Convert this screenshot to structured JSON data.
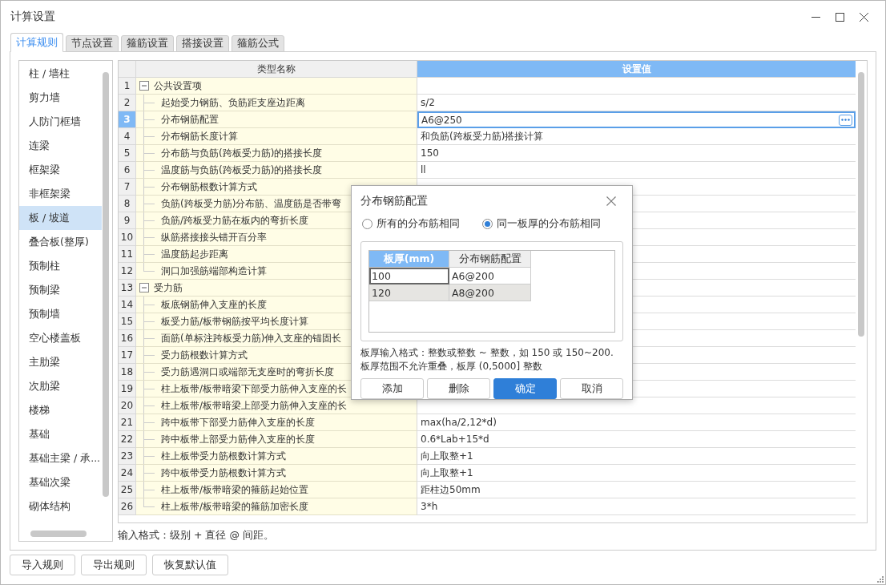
{
  "window": {
    "title": "计算设置"
  },
  "tabs": [
    {
      "label": "计算规则",
      "selected": true
    },
    {
      "label": "节点设置",
      "selected": false
    },
    {
      "label": "箍筋设置",
      "selected": false
    },
    {
      "label": "搭接设置",
      "selected": false
    },
    {
      "label": "箍筋公式",
      "selected": false
    }
  ],
  "sidebar": {
    "items": [
      {
        "label": "柱 / 墙柱",
        "selected": false
      },
      {
        "label": "剪力墙",
        "selected": false
      },
      {
        "label": "人防门框墙",
        "selected": false
      },
      {
        "label": "连梁",
        "selected": false
      },
      {
        "label": "框架梁",
        "selected": false
      },
      {
        "label": "非框架梁",
        "selected": false
      },
      {
        "label": "板 / 坡道",
        "selected": true
      },
      {
        "label": "叠合板(整厚)",
        "selected": false
      },
      {
        "label": "预制柱",
        "selected": false
      },
      {
        "label": "预制梁",
        "selected": false
      },
      {
        "label": "预制墙",
        "selected": false
      },
      {
        "label": "空心楼盖板",
        "selected": false
      },
      {
        "label": "主肋梁",
        "selected": false
      },
      {
        "label": "次肋梁",
        "selected": false
      },
      {
        "label": "楼梯",
        "selected": false
      },
      {
        "label": "基础",
        "selected": false
      },
      {
        "label": "基础主梁 / 承...",
        "selected": false
      },
      {
        "label": "基础次梁",
        "selected": false
      },
      {
        "label": "砌体结构",
        "selected": false
      }
    ]
  },
  "table": {
    "columns": [
      "类型名称",
      "设置值"
    ],
    "groups": [
      {
        "number": "1",
        "name": "公共设置项",
        "expanded": true,
        "children": [
          {
            "number": "2",
            "name": "起始受力钢筋、负筋距支座边距离",
            "value": "s/2",
            "selected": false
          },
          {
            "number": "3",
            "name": "分布钢筋配置",
            "value": "A6@250",
            "selected": true
          },
          {
            "number": "4",
            "name": "分布钢筋长度计算",
            "value": "和负筋(跨板受力筋)搭接计算",
            "selected": false
          },
          {
            "number": "5",
            "name": "分布筋与负筋(跨板受力筋)的搭接长度",
            "value": "150",
            "selected": false
          },
          {
            "number": "6",
            "name": "温度筋与负筋(跨板受力筋)的搭接长度",
            "value": "ll",
            "selected": false
          },
          {
            "number": "7",
            "name": "分布钢筋根数计算方式",
            "selected": false
          },
          {
            "number": "8",
            "name": "负筋(跨板受力筋)分布筋、温度筋是否带弯",
            "selected": false
          },
          {
            "number": "9",
            "name": "负筋/跨板受力筋在板内的弯折长度",
            "selected": false
          },
          {
            "number": "10",
            "name": "纵筋搭接接头错开百分率",
            "selected": false
          },
          {
            "number": "11",
            "name": "温度筋起步距离",
            "selected": false
          },
          {
            "number": "12",
            "name": "洞口加强筋端部构造计算",
            "selected": false
          }
        ]
      },
      {
        "number": "13",
        "name": "受力筋",
        "expanded": true,
        "children": [
          {
            "number": "14",
            "name": "板底钢筋伸入支座的长度",
            "selected": false
          },
          {
            "number": "15",
            "name": "板受力筋/板带钢筋按平均长度计算",
            "selected": false
          },
          {
            "number": "16",
            "name": "面筋(单标注跨板受力筋)伸入支座的锚固长",
            "selected": false
          },
          {
            "number": "17",
            "name": "受力筋根数计算方式",
            "selected": false
          },
          {
            "number": "18",
            "name": "受力筋遇洞口或端部无支座时的弯折长度",
            "selected": false
          },
          {
            "number": "19",
            "name": "柱上板带/板带暗梁下部受力筋伸入支座的长",
            "selected": false
          },
          {
            "number": "20",
            "name": "柱上板带/板带暗梁上部受力筋伸入支座的长",
            "selected": false
          },
          {
            "number": "21",
            "name": "跨中板带下部受力筋伸入支座的长度",
            "value": "max(ha/2,12*d)",
            "selected": false
          },
          {
            "number": "22",
            "name": "跨中板带上部受力筋伸入支座的长度",
            "value": "0.6*Lab+15*d",
            "selected": false
          },
          {
            "number": "23",
            "name": "柱上板带受力筋根数计算方式",
            "value": "向上取整+1",
            "selected": false
          },
          {
            "number": "24",
            "name": "跨中板带受力筋根数计算方式",
            "value": "向上取整+1",
            "selected": false
          },
          {
            "number": "25",
            "name": "柱上板带/板带暗梁的箍筋起始位置",
            "value": "距柱边50mm",
            "selected": false
          },
          {
            "number": "26",
            "name": "柱上板带/板带暗梁的箍筋加密长度",
            "value": "3*h",
            "selected": false
          }
        ]
      }
    ]
  },
  "hint": "输入格式：级别 + 直径 @ 间距。",
  "buttons": [
    "导入规则",
    "导出规则",
    "恢复默认值"
  ],
  "dialog": {
    "title": "分布钢筋配置",
    "options": [
      {
        "label": "所有的分布筋相同",
        "selected": false
      },
      {
        "label": "同一板厚的分布筋相同",
        "selected": true
      }
    ],
    "grid": {
      "columns": [
        "板厚(mm)",
        "分布钢筋配置"
      ],
      "rows": [
        {
          "cells": [
            "100",
            "A6@200"
          ],
          "selected": true
        },
        {
          "cells": [
            "120",
            "A8@200"
          ],
          "selected": false
        }
      ]
    },
    "notes": [
      "板厚输入格式：整数或整数 ~ 整数，如 150 或 150~200.",
      "板厚范围不允许重叠，板厚 (0,5000] 整数"
    ],
    "buttons": [
      {
        "label": "添加",
        "primary": false
      },
      {
        "label": "删除",
        "primary": false
      },
      {
        "label": "确定",
        "primary": true
      },
      {
        "label": "取消",
        "primary": false
      }
    ]
  }
}
